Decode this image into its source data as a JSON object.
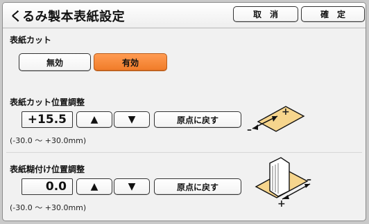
{
  "header": {
    "title": "くるみ製本表紙設定",
    "cancel_label": "取　消",
    "confirm_label": "確　定"
  },
  "cover_cut": {
    "label": "表紙カット",
    "options": [
      "無効",
      "有効"
    ],
    "selected": "有効"
  },
  "cut_position": {
    "label": "表紙カット位置調整",
    "value": "+15.5",
    "up_label": "▲",
    "down_label": "▼",
    "reset_label": "原点に戻す",
    "range_text": "(-30.0 ～ +30.0mm)",
    "diagram_plus": "+",
    "diagram_minus": "–"
  },
  "glue_position": {
    "label": "表紙糊付け位置調整",
    "value": "0.0",
    "up_label": "▲",
    "down_label": "▼",
    "reset_label": "原点に戻す",
    "range_text": "(-30.0 ～ +30.0mm)",
    "diagram_plus": "+",
    "diagram_minus": "–"
  },
  "colors": {
    "accent": "#f07b28",
    "paper": "#f6d58d"
  }
}
